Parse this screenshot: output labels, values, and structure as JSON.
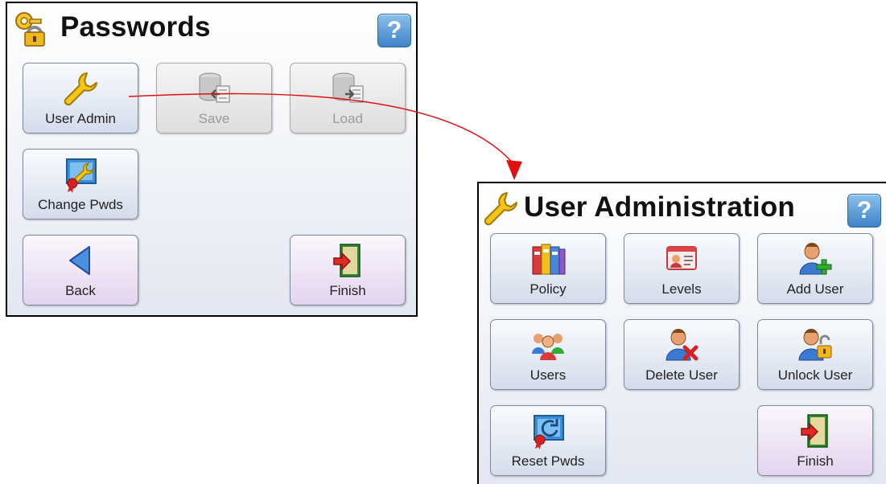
{
  "passwords_panel": {
    "title": "Passwords",
    "help_label": "?",
    "buttons": [
      {
        "label": "User Admin",
        "icon": "wrench-icon",
        "enabled": true
      },
      {
        "label": "Save",
        "icon": "save-database-icon",
        "enabled": false
      },
      {
        "label": "Load",
        "icon": "load-database-icon",
        "enabled": false
      },
      {
        "label": "Change Pwds",
        "icon": "change-passwords-icon",
        "enabled": true
      },
      {
        "label": "Back",
        "icon": "back-arrow-icon",
        "enabled": true
      },
      {
        "label": "Finish",
        "icon": "exit-door-icon",
        "enabled": true
      }
    ]
  },
  "user_admin_panel": {
    "title": "User Administration",
    "help_label": "?",
    "buttons": [
      {
        "label": "Policy",
        "icon": "policy-binders-icon"
      },
      {
        "label": "Levels",
        "icon": "id-card-icon"
      },
      {
        "label": "Add User",
        "icon": "add-user-icon"
      },
      {
        "label": "Users",
        "icon": "users-group-icon"
      },
      {
        "label": "Delete User",
        "icon": "delete-user-icon"
      },
      {
        "label": "Unlock User",
        "icon": "unlock-user-icon"
      },
      {
        "label": "Reset Pwds",
        "icon": "reset-passwords-icon"
      },
      {
        "label": "Finish",
        "icon": "exit-door-icon"
      }
    ]
  },
  "colors": {
    "arrow": "#e01010",
    "help_button": "#3d82c8",
    "nav_button": "#e3d4ee"
  }
}
